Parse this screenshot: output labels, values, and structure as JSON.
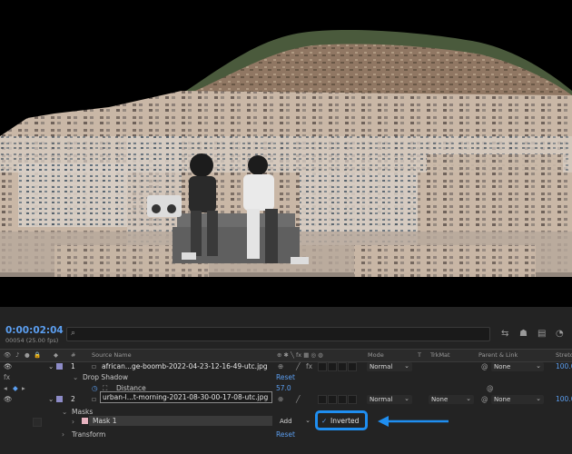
{
  "timeline": {
    "timecode": "0:00:02:04",
    "fps": "00054 (25.00 fps)",
    "search_icon": "⌕",
    "headers": {
      "source_name": "Source Name",
      "mode": "Mode",
      "t": "T",
      "trkmat": "TrkMat",
      "parent_link": "Parent & Link",
      "stretch": "Stretc"
    },
    "layers": [
      {
        "number": "1",
        "name": "african...ge-boomb-2022-04-23-12-16-49-utc.jpg",
        "mode": "Normal",
        "parent": "None",
        "stretch": "100.0",
        "color": "#8d8bc7",
        "effects": [
          {
            "label": "Drop Shadow",
            "reset": "Reset"
          },
          {
            "label": "Distance",
            "value": "57.0"
          }
        ]
      },
      {
        "number": "2",
        "name": "urban-l...t-morning-2021-08-30-00-17-08-utc.jpg",
        "mode": "Normal",
        "trkmat": "None",
        "parent": "None",
        "stretch": "100.0",
        "color": "#8d8bc7",
        "masks_label": "Masks",
        "mask": {
          "name": "Mask 1",
          "mode": "Add",
          "inverted_label": "Inverted",
          "checked": true
        },
        "transform_label": "Transform",
        "reset": "Reset"
      }
    ],
    "fx_label": "fx",
    "highlight_color": "#1f8ef0"
  }
}
